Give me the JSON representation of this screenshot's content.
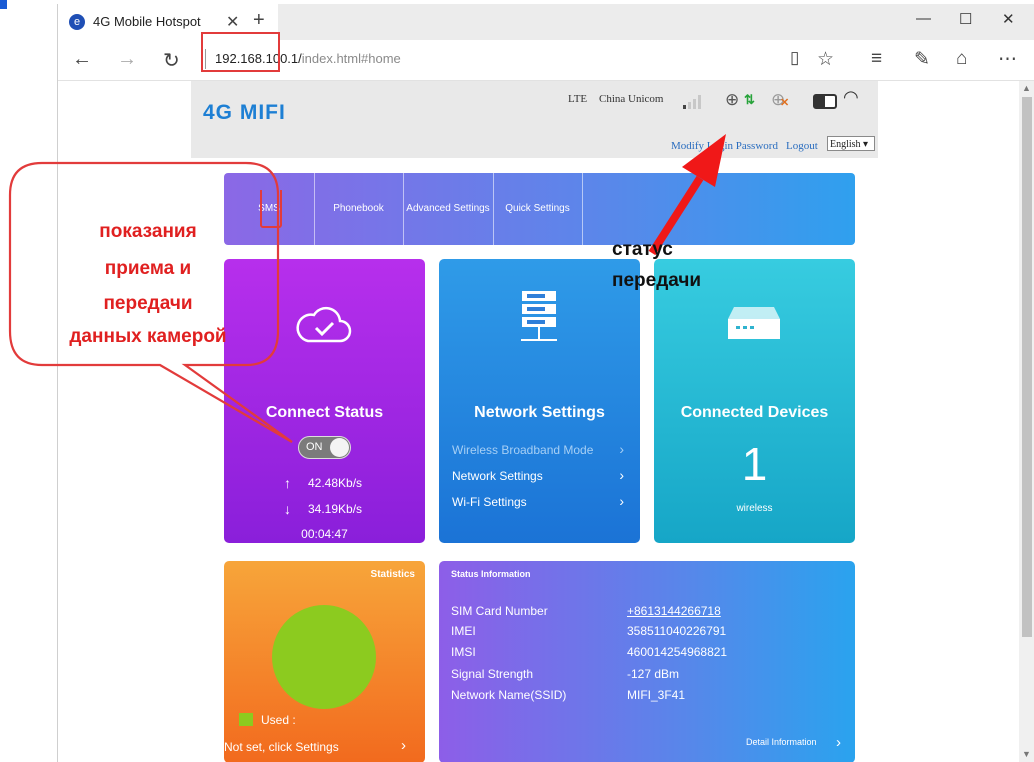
{
  "browser": {
    "tab_title": "4G Mobile Hotspot",
    "tab_favicon": "e",
    "tab_close": "✕",
    "new_tab": "+",
    "url_host": "192.168.100.1/",
    "url_path": "index.html#home",
    "win_minimize": "—",
    "win_maximize": "☐",
    "win_close": "✕",
    "nav_back": "←",
    "nav_forward": "→",
    "nav_refresh": "↻",
    "tool_reading": "▯",
    "tool_favorite": "☆",
    "tool_hub": "≡",
    "tool_note": "✎",
    "tool_share": "⌂",
    "tool_more": "⋯"
  },
  "header": {
    "logo": "4G MIFI",
    "network_type": "LTE",
    "operator": "China Unicom",
    "modify_password": "Modify Login Password",
    "logout": "Logout",
    "language": "English ▾",
    "icons": [
      "signal-icon",
      "globe-icon",
      "data-arrows-icon",
      "globe-disconnected-icon",
      "battery-icon",
      "wifi-icon"
    ]
  },
  "menu": [
    "SMS",
    "Phonebook",
    "Advanced Settings",
    "Quick Settings"
  ],
  "connect": {
    "title": "Connect Status",
    "toggle": "ON",
    "upload": "42.48Kb/s",
    "download": "34.19Kb/s",
    "duration": "00:04:47",
    "up_arrow": "↑",
    "down_arrow": "↓"
  },
  "network": {
    "title": "Network Settings",
    "links": [
      "Wireless Broadband Mode",
      "Network Settings",
      "Wi-Fi Settings"
    ],
    "chev": "›"
  },
  "devices": {
    "title": "Connected Devices",
    "count": "1",
    "type": "wireless"
  },
  "stats": {
    "title": "Statistics",
    "used_label": "Used  :",
    "link": "Not set, click Settings",
    "chev": "›"
  },
  "status_info": {
    "title": "Status Information",
    "rows": [
      {
        "k": "SIM Card Number",
        "v": "+8613144266718"
      },
      {
        "k": "IMEI",
        "v": "358511040226791"
      },
      {
        "k": "IMSI",
        "v": "460014254968821"
      },
      {
        "k": "Signal Strength",
        "v": "-127 dBm"
      },
      {
        "k": "Network Name(SSID)",
        "v": "MIFI_3F41"
      }
    ],
    "detail": "Detail Information",
    "chev": "›"
  },
  "annotations": {
    "red_lines": [
      "показания",
      "приема и",
      "передачи",
      "данных камерой"
    ],
    "black_lines": [
      "статус",
      "передачи"
    ],
    "accent": "#e02020"
  },
  "colors": {
    "logo": "#1d7fd4",
    "data_arrows": "#27a33a",
    "pie_used": "#8ccb1f",
    "highlight": "#e23b3b"
  }
}
